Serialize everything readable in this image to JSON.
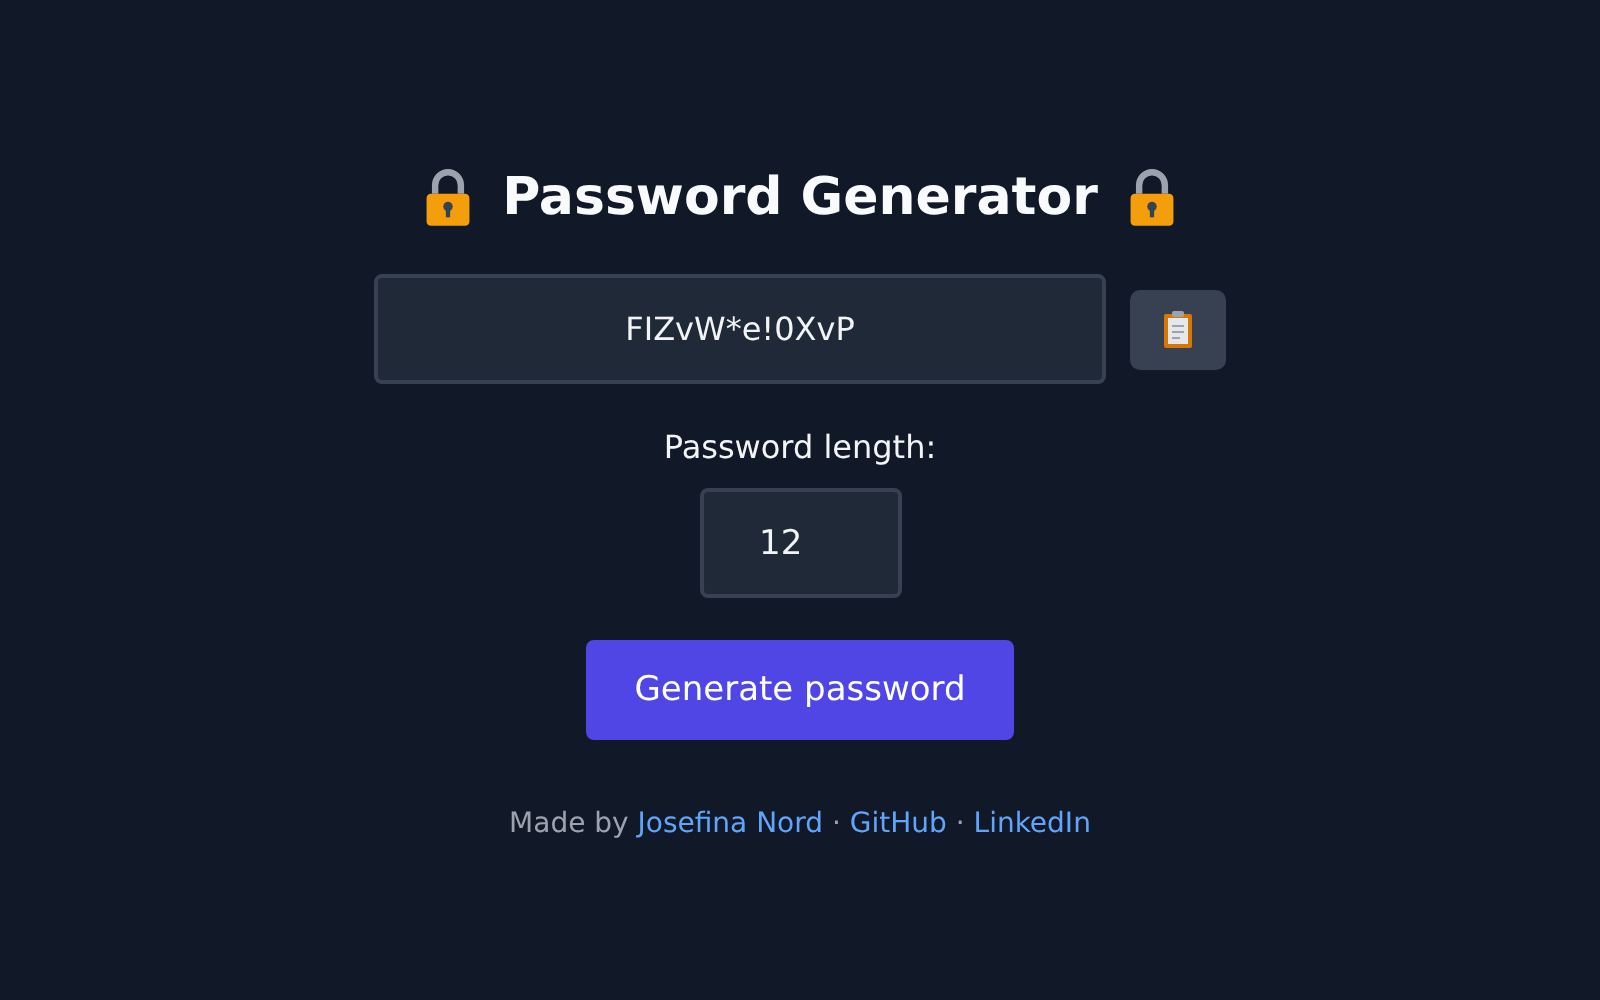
{
  "title": "Password Generator",
  "password": {
    "value": "FIZvW*e!0XvP"
  },
  "length": {
    "label": "Password length:",
    "value": "12"
  },
  "generate_button": "Generate password",
  "footer": {
    "prefix": "Made by",
    "parts": [
      {
        "kind": "link",
        "text": "Josefina Nord"
      },
      {
        "kind": "separator",
        "text": "·"
      },
      {
        "kind": "link",
        "text": "GitHub"
      },
      {
        "kind": "separator",
        "text": "·"
      },
      {
        "kind": "link",
        "text": "LinkedIn"
      }
    ]
  }
}
